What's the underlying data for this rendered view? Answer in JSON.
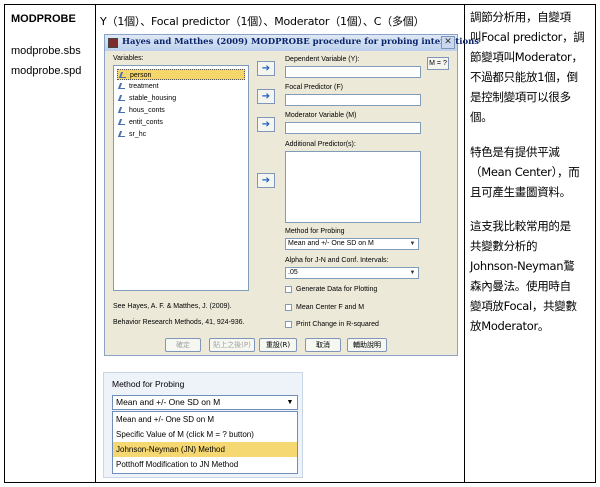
{
  "col1": {
    "title": "MODPROBE",
    "files": [
      "modprobe.sbs",
      "modprobe.spd"
    ]
  },
  "col2": {
    "header": "Y（1個）、Focal predictor（1個）、Moderator（1個）、C（多個）"
  },
  "dialog": {
    "title": "Hayes and Matthes (2009) MODPROBE procedure for probing interactions",
    "close_glyph": "✕",
    "variables_label": "Variables:",
    "variables": [
      "person",
      "treatment",
      "stable_housing",
      "hous_conts",
      "entit_conts",
      "sr_hc"
    ],
    "selected_variable": "person",
    "dependent_label": "Dependent Variable (Y):",
    "focal_label": "Focal Predictor (F)",
    "moderator_label": "Moderator Variable (M)",
    "additional_label": "Additional Predictor(s):",
    "m_button": "M = ?",
    "method_label": "Method for Probing",
    "method_value": "Mean and +/- One SD on M",
    "alpha_label": "Alpha for J-N and Conf. Intervals:",
    "alpha_value": ".05",
    "checkboxes": [
      "Generate Data for Plotting",
      "Mean Center F and M",
      "Print Change in R-squared"
    ],
    "reference": [
      "See Hayes, A. F. & Matthes, J. (2009).",
      "Behavior Research Methods, 41, 924-936."
    ],
    "buttons": {
      "ok": "確定",
      "paste": "貼上之後(P)",
      "reset": "重設(R)",
      "cancel": "取消",
      "help": "輔助說明"
    }
  },
  "zoom": {
    "label": "Method for Probing",
    "value": "Mean and +/- One SD on M",
    "options": [
      "Mean and +/- One SD on M",
      "Specific Value of M (click M = ? button)",
      "Johnson-Neyman (JN) Method",
      "Potthoff Modification to JN Method"
    ],
    "selected_index": 2
  },
  "col3": {
    "lines": [
      "調節分析用，自變項",
      "叫Focal predictor，調",
      "節變項叫Moderator，",
      "不過都只能放1個，倒",
      "是控制變項可以很多",
      "個。",
      "",
      "特色是有提供平減",
      "（Mean Center），而",
      "且可產生畫圖資料。",
      "",
      "這支我比較常用的是",
      "共變數分析的",
      "Johnson-Neyman鶩",
      "森內曼法。使用時自",
      "變項放Focal，共變數",
      "放Moderator。"
    ]
  },
  "colors": {
    "selection": "#f5d66a",
    "dialog_bg": "#ece9d8",
    "titlebar": "#bcd0ec",
    "arrow": "#1f5fbf"
  }
}
